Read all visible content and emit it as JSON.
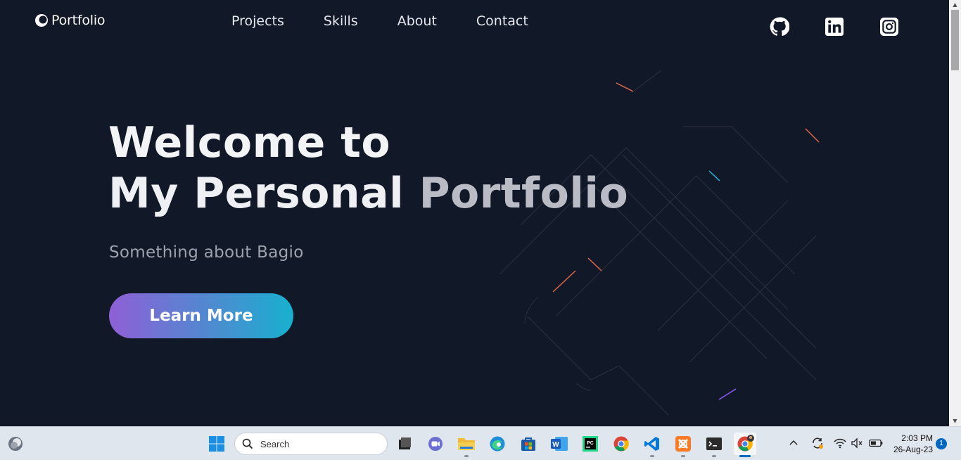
{
  "site": {
    "brand": "Portfolio",
    "nav": [
      "Projects",
      "Skills",
      "About",
      "Contact"
    ],
    "socials": [
      "github-icon",
      "linkedin-icon",
      "instagram-icon"
    ]
  },
  "hero": {
    "title_line1": "Welcome to",
    "title_line2a": "My Personal ",
    "title_line2b": "Portfolio",
    "subtitle": "Something about Bagio",
    "cta": "Learn More"
  },
  "colors": {
    "background": "#111827",
    "cta_gradient_start": "#8f5fd6",
    "cta_gradient_end": "#18b0cf"
  },
  "taskbar": {
    "search_placeholder": "Search",
    "apps": [
      "file-manager",
      "teams-meet",
      "file-explorer",
      "edge",
      "store",
      "word",
      "pycharm",
      "chrome",
      "vscode",
      "xampp",
      "terminal",
      "chrome-profile"
    ],
    "time": "2:03 PM",
    "date": "26-Aug-23",
    "notification_count": "1"
  }
}
